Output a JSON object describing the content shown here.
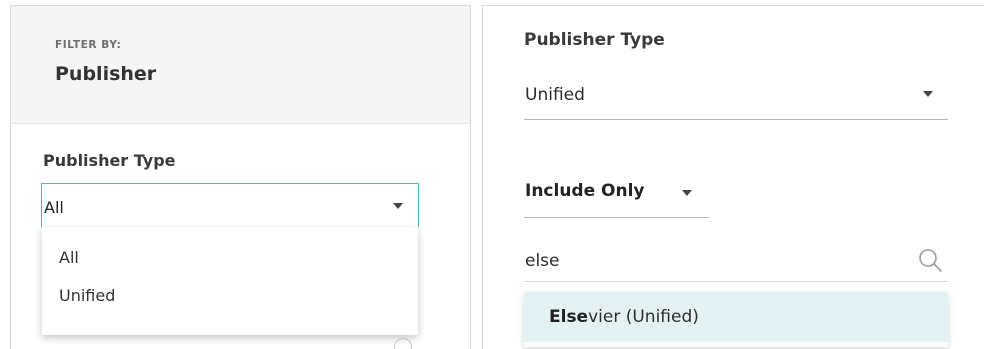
{
  "left_panel": {
    "filter_by_label": "FILTER BY:",
    "title": "Publisher",
    "publisher_type_label": "Publisher Type",
    "publisher_type_value": "All",
    "publisher_type_options": [
      "All",
      "Unified"
    ]
  },
  "right_panel": {
    "publisher_type_label": "Publisher Type",
    "publisher_type_value": "Unified",
    "include_only_label": "Include Only",
    "search_value": "else",
    "suggestion": {
      "match": "Else",
      "rest": "vier (Unified)"
    }
  },
  "icons": {
    "caret": "caret-down-icon",
    "search": "search-icon",
    "help": "help-icon"
  },
  "colors": {
    "focus_border": "#5bb0b5",
    "highlight_bg": "#e4f1f2",
    "header_bg": "#f5f5f5"
  }
}
